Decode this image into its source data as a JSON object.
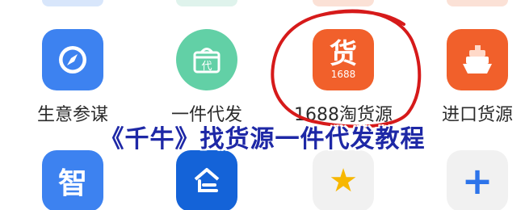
{
  "colors": {
    "blue": "#3d82f0",
    "mint": "#62d0a6",
    "orange": "#f1602b",
    "grey_tile": "#f1f1f1",
    "title_blue": "#1e28a6",
    "annotation_red": "#d61a1a",
    "star_yellow": "#f7b700",
    "plus_blue": "#2d74ea"
  },
  "apps_row1": [
    {
      "label": "生意参谋",
      "icon": "compass-icon"
    },
    {
      "label": "一件代发",
      "icon": "gift-box-icon",
      "glyph": "代"
    },
    {
      "label": "1688淘货源",
      "icon": "goods-icon",
      "glyph": "货",
      "sub": "1688"
    },
    {
      "label": "进口货源",
      "icon": "ship-icon"
    }
  ],
  "apps_row2": [
    {
      "label": "",
      "icon": "zhi-icon",
      "glyph": "智"
    },
    {
      "label": "",
      "icon": "warehouse-icon"
    },
    {
      "label": "",
      "icon": "star-icon",
      "glyph": "★"
    },
    {
      "label": "",
      "icon": "plus-icon",
      "glyph": "+"
    }
  ],
  "overlay_title": "《千牛》找货源一件代发教程"
}
